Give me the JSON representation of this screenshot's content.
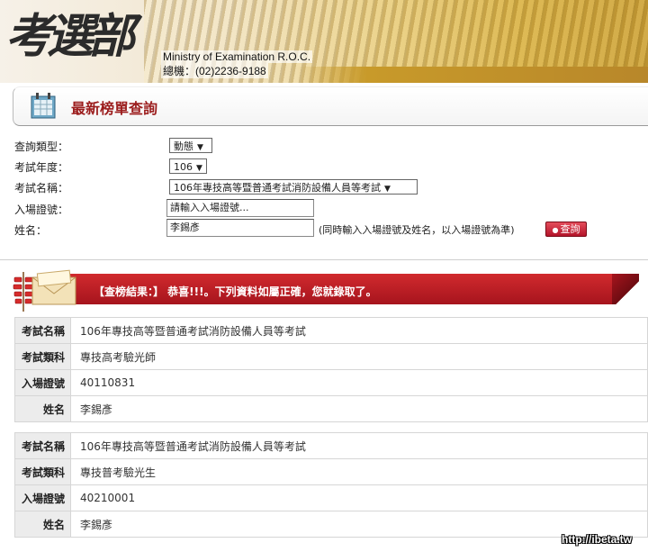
{
  "header": {
    "logo_text": "考選部",
    "english_name": "Ministry of Examination R.O.C.",
    "phone": "總機：(02)2236-9188"
  },
  "section": {
    "title": "最新榜單查詢"
  },
  "form": {
    "query_type_label": "查詢類型：",
    "query_type_value": "動態",
    "exam_year_label": "考試年度：",
    "exam_year_value": "106",
    "exam_name_label": "考試名稱：",
    "exam_name_value": "106年專技高等暨普通考試消防設備人員等考試",
    "ticket_label": "入場證號：",
    "ticket_placeholder": "請輸入入場證號...",
    "name_label": "姓名：",
    "name_value": "李錫彥",
    "hint": "(同時輸入入場證號及姓名，以入場證號為準)",
    "query_button": "查詢"
  },
  "result": {
    "message": "【查榜結果：】 恭喜!!!。下列資料如屬正確，您就錄取了。",
    "records": [
      {
        "exam_name_key": "考試名稱",
        "exam_name": "106年專技高等暨普通考試消防設備人員等考試",
        "category_key": "考試類科",
        "category": "專技高考驗光師",
        "ticket_key": "入場證號",
        "ticket": "40110831",
        "name_key": "姓名",
        "name": "李錫彥"
      },
      {
        "exam_name_key": "考試名稱",
        "exam_name": "106年專技高等暨普通考試消防設備人員等考試",
        "category_key": "考試類科",
        "category": "專技普考驗光生",
        "ticket_key": "入場證號",
        "ticket": "40210001",
        "name_key": "姓名",
        "name": "李錫彥"
      }
    ]
  },
  "watermark": "http://ibeta.tw",
  "colors": {
    "title_red": "#9b1c1c",
    "banner_red": "#c0202a",
    "button_red": "#b3142a"
  }
}
